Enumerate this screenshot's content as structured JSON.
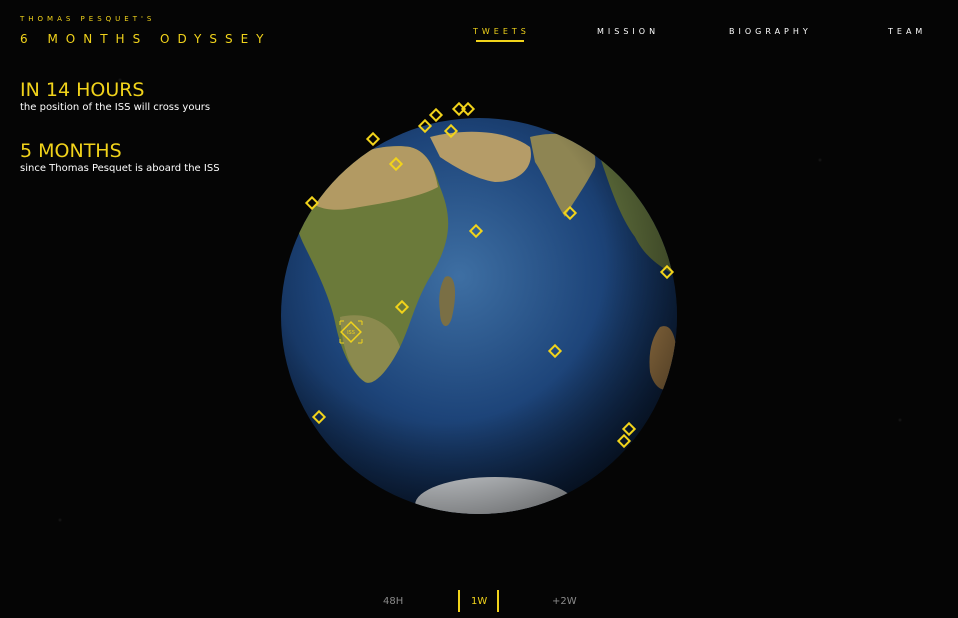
{
  "brand": {
    "subtitle": "Thomas Pesquet's",
    "title": "6 Months Odyssey"
  },
  "nav": {
    "items": [
      {
        "label": "TWEETS",
        "active": true
      },
      {
        "label": "MISSION",
        "active": false
      },
      {
        "label": "BIOGRAPHY",
        "active": false
      },
      {
        "label": "TEAM",
        "active": false
      }
    ]
  },
  "info": {
    "iss_eta": {
      "headline": "IN 14 HOURS",
      "text": "the position of the ISS will cross yours"
    },
    "time_aboard": {
      "headline": "5 MONTHS",
      "text": "since Thomas Pesquet is aboard the ISS"
    }
  },
  "globe": {
    "iss_label": "ISS",
    "marker_count": 20
  },
  "timeline": {
    "options": [
      {
        "label": "48H",
        "active": false
      },
      {
        "label": "1W",
        "active": true
      },
      {
        "label": "+2W",
        "active": false
      }
    ]
  },
  "colors": {
    "accent": "#f1d31b",
    "background": "#050505",
    "text": "#ffffff",
    "muted": "#8a8a8a"
  }
}
